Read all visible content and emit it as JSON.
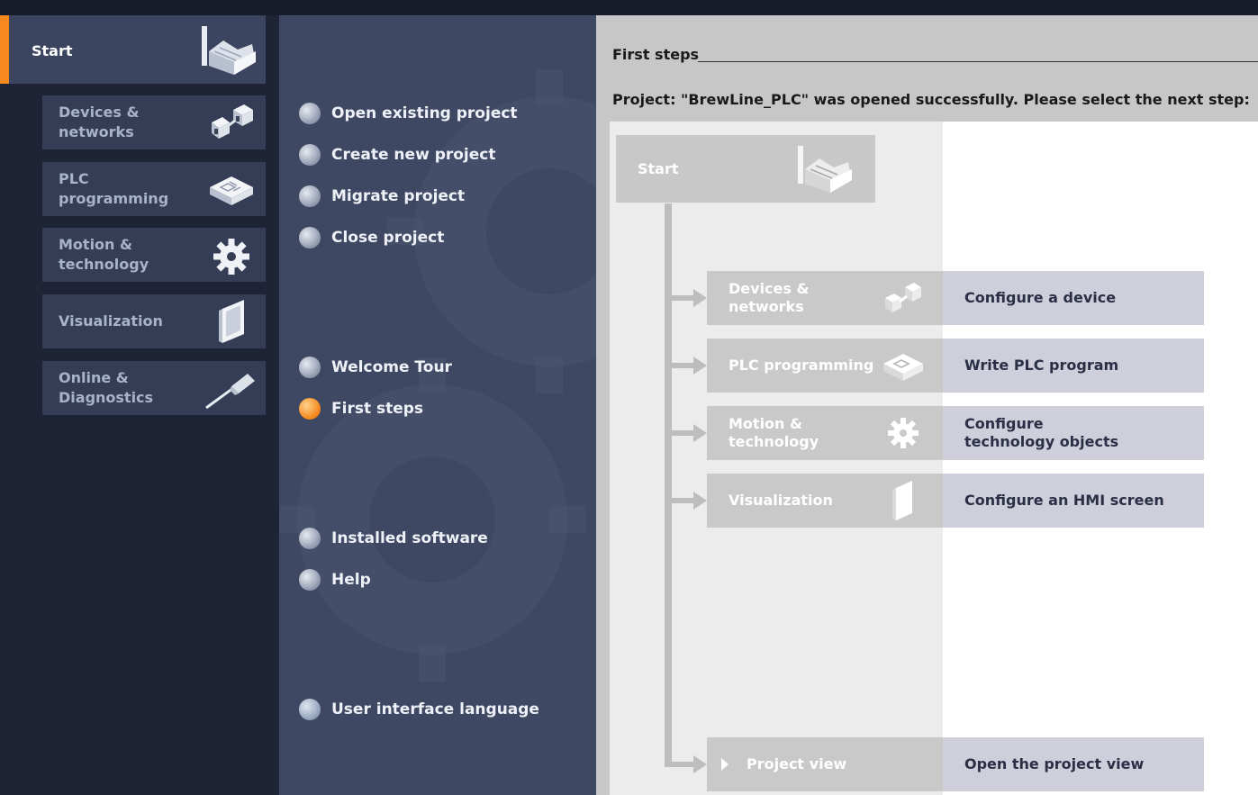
{
  "nav": {
    "start_label": "Start",
    "items": [
      {
        "label": "Devices &\nnetworks"
      },
      {
        "label": "PLC\nprogramming"
      },
      {
        "label": "Motion &\ntechnology"
      },
      {
        "label": "Visualization"
      },
      {
        "label": "Online &\nDiagnostics"
      }
    ]
  },
  "actions": {
    "open_existing": "Open existing project",
    "create_new": "Create new project",
    "migrate": "Migrate project",
    "close": "Close project",
    "welcome_tour": "Welcome Tour",
    "first_steps": "First steps",
    "installed_software": "Installed software",
    "help": "Help",
    "ui_language": "User interface language"
  },
  "content": {
    "title": "First steps",
    "message": "Project: \"BrewLine_PLC\" was opened successfully. Please select the next step:",
    "start_label": "Start",
    "steps": [
      {
        "portal": "Devices &\nnetworks",
        "action": "Configure a device"
      },
      {
        "portal": "PLC programming",
        "action": "Write PLC program"
      },
      {
        "portal": "Motion &\ntechnology",
        "action": "Configure\ntechnology objects"
      },
      {
        "portal": "Visualization",
        "action": "Configure an HMI screen"
      },
      {
        "portal": "Project view",
        "action": "Open the project view"
      }
    ]
  },
  "colors": {
    "accent": "#f5891e",
    "nav_bg": "#1e2435",
    "panel_bg": "#3f4862"
  }
}
